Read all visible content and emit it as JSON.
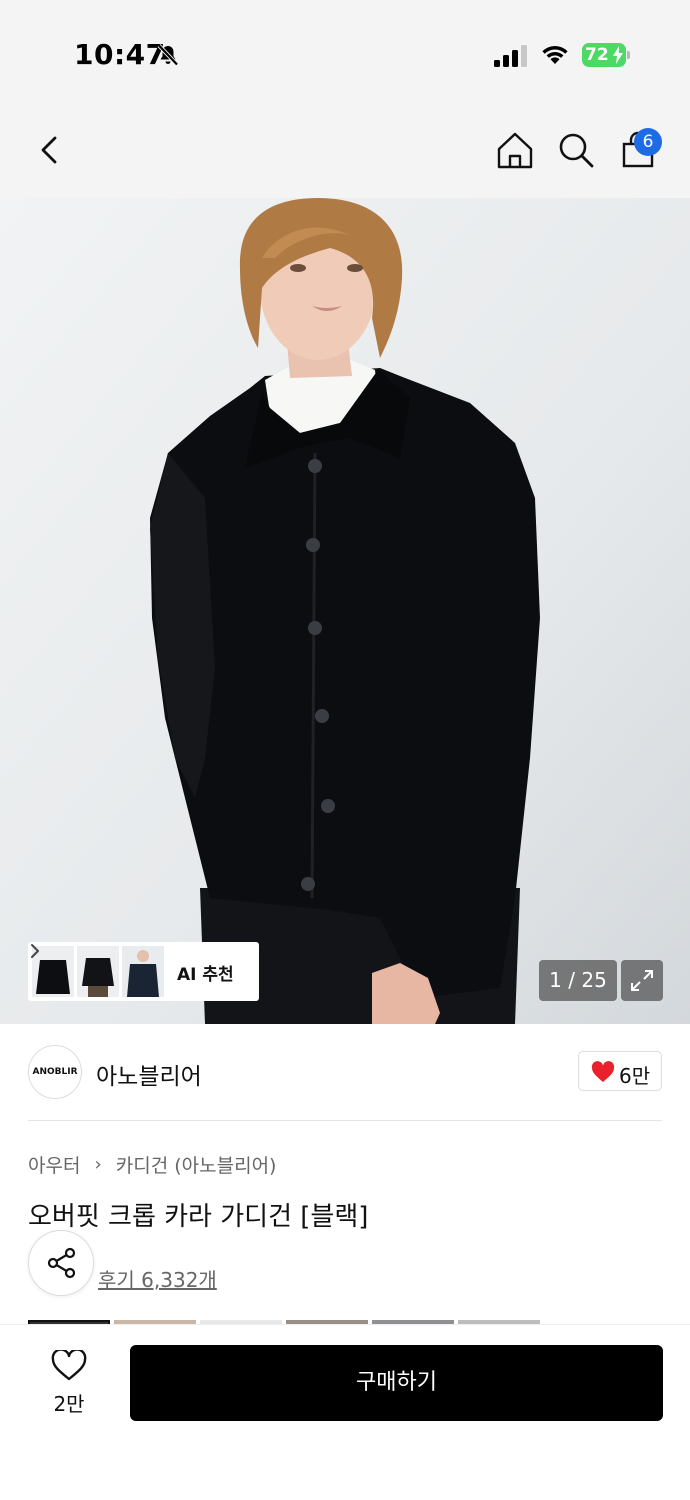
{
  "status_bar": {
    "time": "10:47",
    "battery": "72"
  },
  "nav": {
    "cart_count": "6"
  },
  "gallery": {
    "ai_label": "AI 추천",
    "page_counter": "1 / 25"
  },
  "brand": {
    "logo_text": "ANOBLIR",
    "name": "아노블리어",
    "likes": "6만"
  },
  "product": {
    "breadcrumb": [
      "아우터",
      "카디건 (아노블리어)"
    ],
    "title": "오버핏 크롭 카라 가디건 [블랙]",
    "reviews": "후기 6,332개"
  },
  "bottom_bar": {
    "wish_count": "2만",
    "buy_label": "구매하기"
  }
}
